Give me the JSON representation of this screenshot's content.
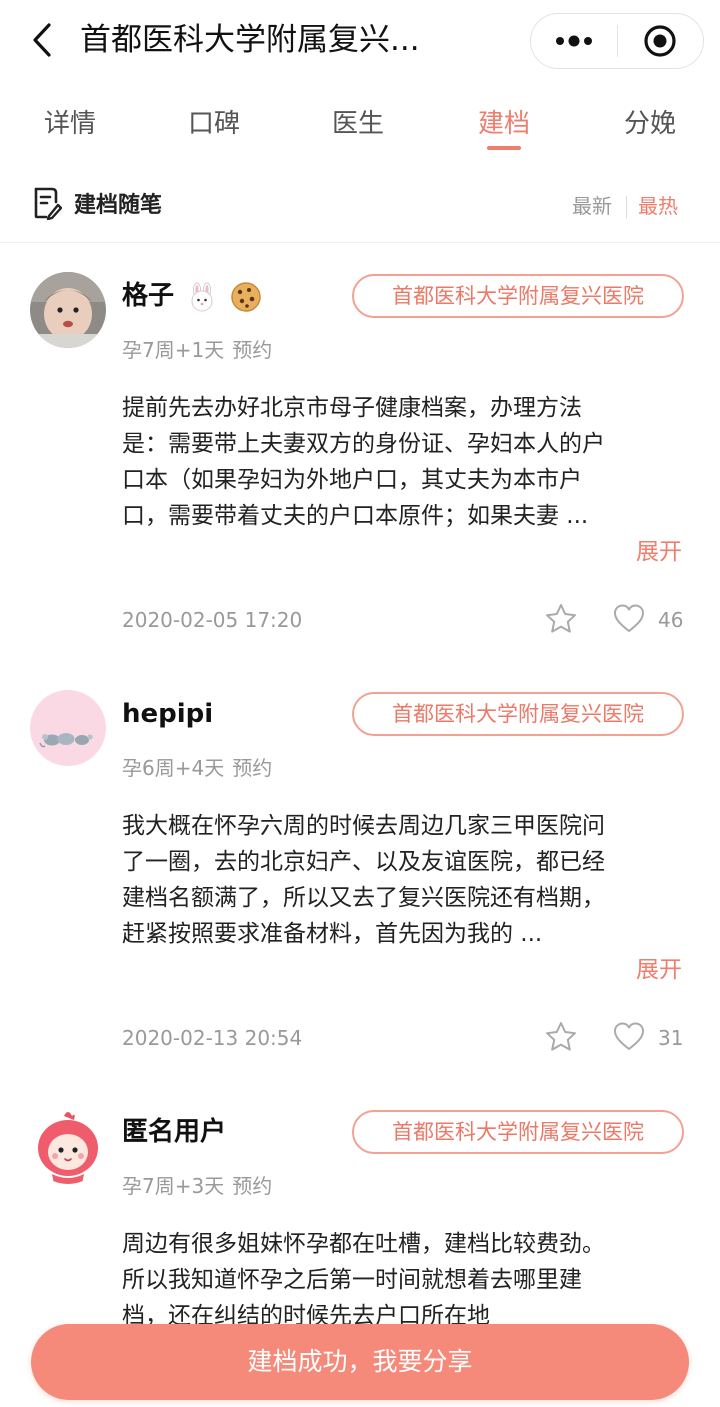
{
  "header": {
    "title": "首都医科大学附属复兴...",
    "back_icon": "chevron-left-icon",
    "more_icon": "more-dots-icon",
    "close_icon": "target-close-icon"
  },
  "tabs": [
    {
      "label": "详情",
      "active": false
    },
    {
      "label": "口碑",
      "active": false
    },
    {
      "label": "医生",
      "active": false
    },
    {
      "label": "建档",
      "active": true
    },
    {
      "label": "分娩",
      "active": false
    }
  ],
  "section": {
    "title": "建档随笔",
    "sort_new": "最新",
    "sort_hot": "最热",
    "active_sort": "最热"
  },
  "posts": [
    {
      "username": "格子",
      "username_emojis": [
        "rabbit-face-icon",
        "cookie-icon"
      ],
      "hospital": "首都医科大学附属复兴医院",
      "week": "孕7周+1天",
      "status": "预约",
      "content": "提前先去办好北京市母子健康档案，办理方法是：需要带上夫妻双方的身份证、孕妇本人的户口本（如果孕妇为外地户口，其丈夫为本市户口，需要带着丈夫的户口本原件；如果夫妻 ...",
      "expand": "展开",
      "date": "2020-02-05 17:20",
      "likes": "46"
    },
    {
      "username": "hepipi",
      "hospital": "首都医科大学附属复兴医院",
      "week": "孕6周+4天",
      "status": "预约",
      "content": "我大概在怀孕六周的时候去周边几家三甲医院问了一圈，去的北京妇产、以及友谊医院，都已经建档名额满了，所以又去了复兴医院还有档期，赶紧按照要求准备材料，首先因为我的 ...",
      "expand": "展开",
      "date": "2020-02-13 20:54",
      "likes": "31"
    },
    {
      "username": "匿名用户",
      "hospital": "首都医科大学附属复兴医院",
      "week": "孕7周+3天",
      "status": "预约",
      "content": "周边有很多姐妹怀孕都在吐槽，建档比较费劲。所以我知道怀孕之后第一时间就想着去哪里建档，还在纠结的时候先去户口所在地"
    }
  ],
  "share_button": "建档成功，我要分享",
  "colors": {
    "accent": "#f07e6e",
    "button": "#f58a7a",
    "tag_border": "#f2a193"
  }
}
